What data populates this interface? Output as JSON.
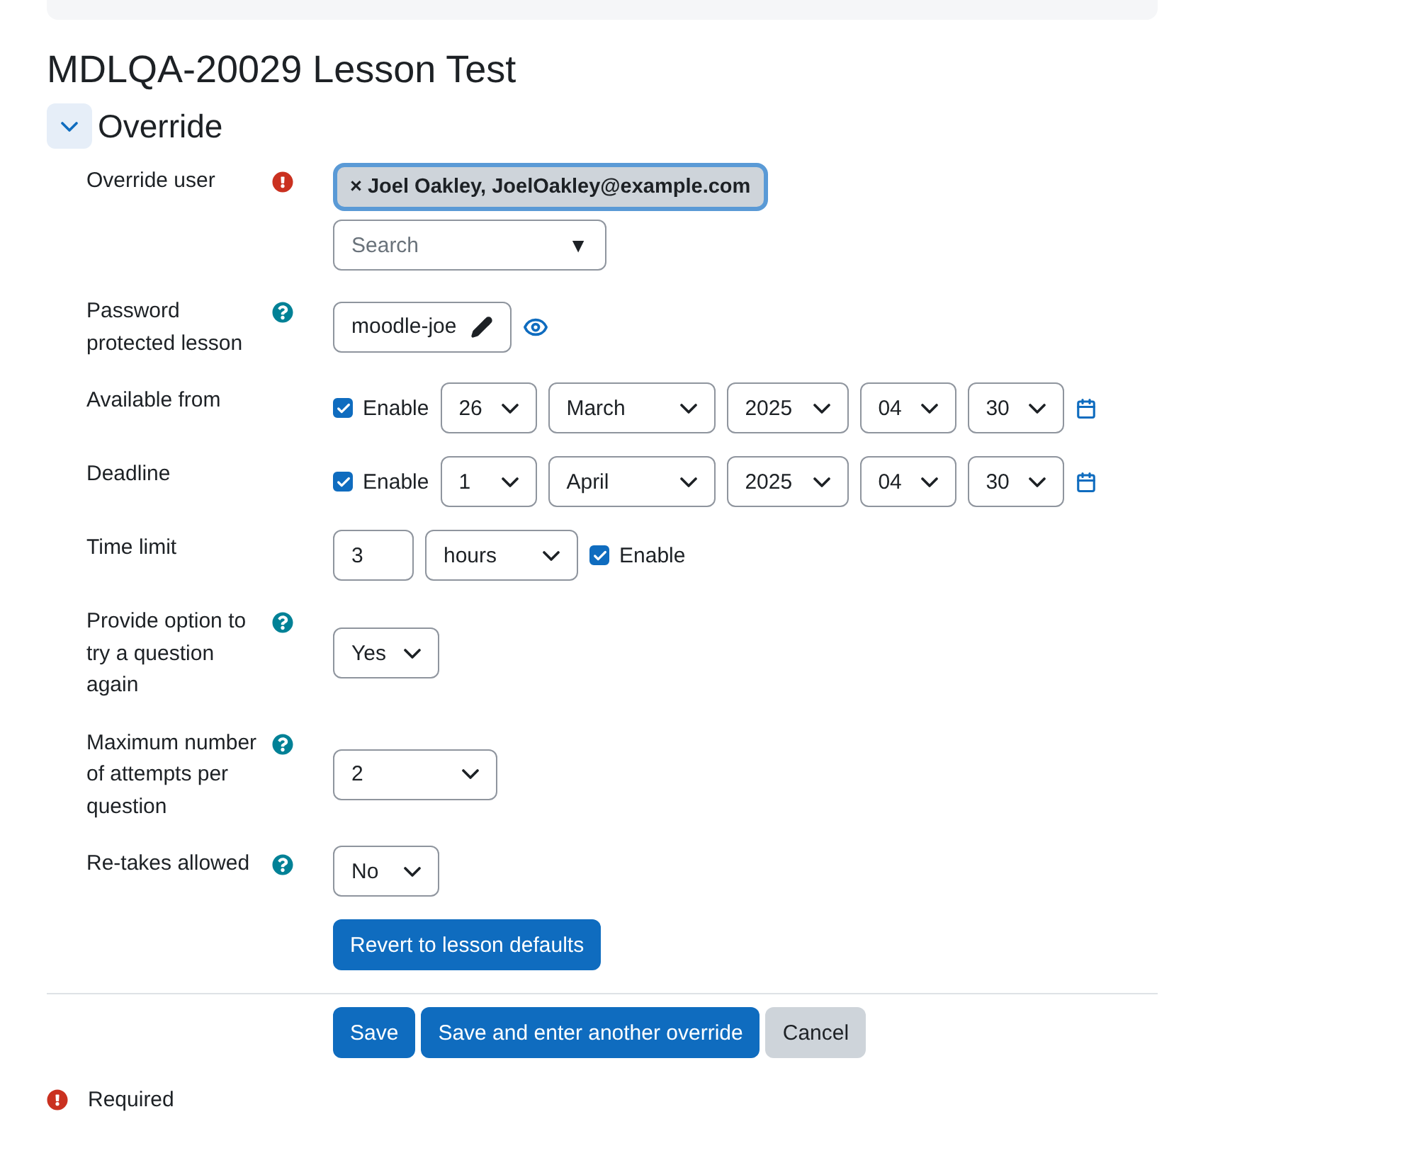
{
  "page_title": "MDLQA-20029 Lesson Test",
  "section": {
    "title": "Override",
    "expanded": true
  },
  "fields": [
    {
      "label": "Override user",
      "required": true,
      "help": false,
      "kind": "autocomplete",
      "selection": "× Joel Oakley, JoelOakley@example.com",
      "placeholder": "Search",
      "arrow": "▼"
    },
    {
      "label": "Password protected lesson",
      "required": false,
      "help": true,
      "kind": "password",
      "value": "moodle-joe"
    },
    {
      "label": "Available from",
      "kind": "date",
      "enabled": true,
      "enable_label": "Enable",
      "selects": [
        "26",
        "March",
        "2025",
        "04",
        "30"
      ]
    },
    {
      "label": "Deadline",
      "kind": "date",
      "enabled": true,
      "enable_label": "Enable",
      "selects": [
        "1",
        "April",
        "2025",
        "04",
        "30"
      ]
    },
    {
      "label": "Time limit",
      "kind": "duration",
      "value": "3",
      "unit": "hours",
      "enabled": true,
      "enable_label": "Enable"
    },
    {
      "label": "Provide option to try a question again",
      "required": false,
      "help": true,
      "kind": "select",
      "value": "Yes"
    },
    {
      "label": "Maximum number of attempts per question",
      "required": false,
      "help": true,
      "kind": "select",
      "value": "2"
    },
    {
      "label": "Re-takes allowed",
      "required": false,
      "help": true,
      "kind": "select",
      "value": "No"
    }
  ],
  "revert_button": "Revert to lesson defaults",
  "buttons": [
    {
      "label": "Save",
      "kind": "primary"
    },
    {
      "label": "Save and enter another override",
      "kind": "primary"
    },
    {
      "label": "Cancel",
      "kind": "secondary"
    }
  ],
  "required_note": "Required"
}
